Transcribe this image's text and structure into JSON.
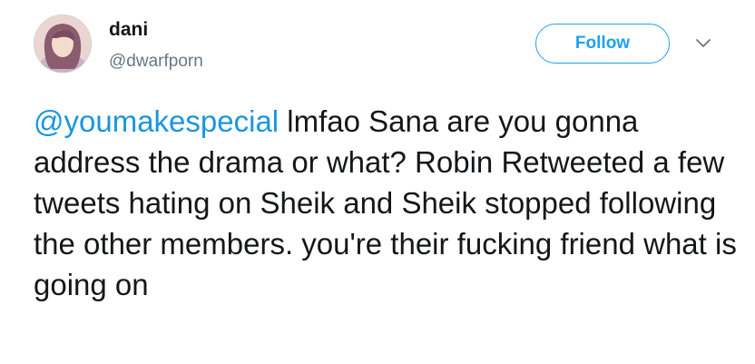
{
  "user": {
    "name": "dani",
    "handle": "@dwarfporn"
  },
  "actions": {
    "follow_label": "Follow"
  },
  "tweet": {
    "mention": "@youmakespecial",
    "text": " lmfao Sana are you gonna address the drama or what? Robin Retweeted a few tweets hating on Sheik and Sheik stopped following the other members. you're their fucking friend what is going on"
  },
  "icons": {
    "menu": "chevron-down-icon"
  },
  "colors": {
    "accent": "#1da1f2",
    "mention": "#1b95e0",
    "text": "#14171a",
    "muted": "#657786"
  }
}
